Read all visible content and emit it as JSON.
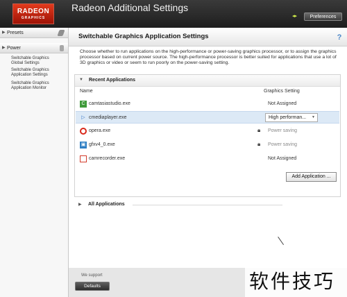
{
  "window": {
    "title": "Radeon Additional Settings",
    "logo_line1": "RADEON",
    "logo_line2": "GRAPHICS",
    "preferences_label": "Preferences"
  },
  "sidebar": {
    "sections": [
      {
        "label": "Presets",
        "icon": "presets-icon",
        "expanded": false
      },
      {
        "label": "Power",
        "icon": "power-icon",
        "expanded": false
      }
    ],
    "items": [
      {
        "label_line1": "Switchable Graphics",
        "label_line2": "Global Settings"
      },
      {
        "label_line1": "Switchable Graphics",
        "label_line2": "Application Settings"
      },
      {
        "label_line1": "Switchable Graphics",
        "label_line2": "Application Monitor"
      }
    ]
  },
  "main": {
    "title": "Switchable Graphics Application Settings",
    "description": "Choose whether to run applications on the high-performance or power-saving graphics processor, or to assign the graphics processor based on current power source. The high-performance processor is better suited for applications that use a lot of 3D graphics or video or seem to run poorly on the power-saving setting.",
    "recent_section_label": "Recent Applications",
    "columns": {
      "name": "Name",
      "setting": "Graphics Setting"
    },
    "rows": [
      {
        "name": "camtasiastudio.exe",
        "setting": "Not Assigned",
        "icon": "camtasia-icon",
        "locked": false,
        "dropdown": false
      },
      {
        "name": "cmediaplayer.exe",
        "setting": "High performan...",
        "icon": "play-icon",
        "locked": false,
        "dropdown": true
      },
      {
        "name": "opera.exe",
        "setting": "Power saving",
        "icon": "opera-icon",
        "locked": true,
        "dropdown": false
      },
      {
        "name": "gfxv4_0.exe",
        "setting": "Power saving",
        "icon": "gfx-icon",
        "locked": true,
        "dropdown": false
      },
      {
        "name": "camrecorder.exe",
        "setting": "Not Assigned",
        "icon": "recorder-icon",
        "locked": false,
        "dropdown": false
      }
    ],
    "all_apps_label": "All Applications",
    "add_application_label": "Add Application ..."
  },
  "footer": {
    "text": "We support",
    "defaults_label": "Defaults"
  },
  "watermark": "软件技巧",
  "colors": {
    "logo_red": "#c92010",
    "titlebar": "#2a2a2a",
    "selected_row": "#dce9f6",
    "help_blue": "#4b86c8"
  }
}
